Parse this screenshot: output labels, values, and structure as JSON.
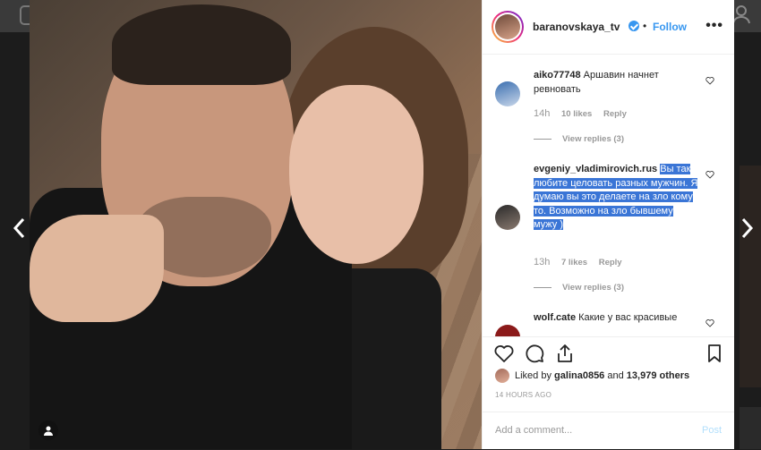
{
  "header": {
    "username": "baranovskaya_tv",
    "dot": "•",
    "follow_label": "Follow",
    "more_label": "•••"
  },
  "comments": [
    {
      "username": "aiko77748",
      "text": "Аршавин начнет ревновать",
      "time": "14h",
      "likes": "10 likes",
      "reply_label": "Reply",
      "view_replies": "View replies (3)"
    },
    {
      "username": "evgeniy_vladimirovich.rus",
      "text": "Вы так любите целовать разных мужчин. Я думаю вы это делаете на зло кому то. Возможно на зло бывшему мужу )",
      "time": "13h",
      "likes": "7 likes",
      "reply_label": "Reply",
      "view_replies": "View replies (3)"
    },
    {
      "username": "wolf.cate",
      "text": "Какие у вас красивые"
    }
  ],
  "likes": {
    "prefix": "Liked by",
    "user": "galina0856",
    "and": "and",
    "count": "13,979 others"
  },
  "timestamp": "14 HOURS AGO",
  "add_comment": {
    "placeholder": "Add a comment...",
    "post_label": "Post"
  },
  "colors": {
    "accent": "#3897f0",
    "highlight": "#3a75d6"
  }
}
